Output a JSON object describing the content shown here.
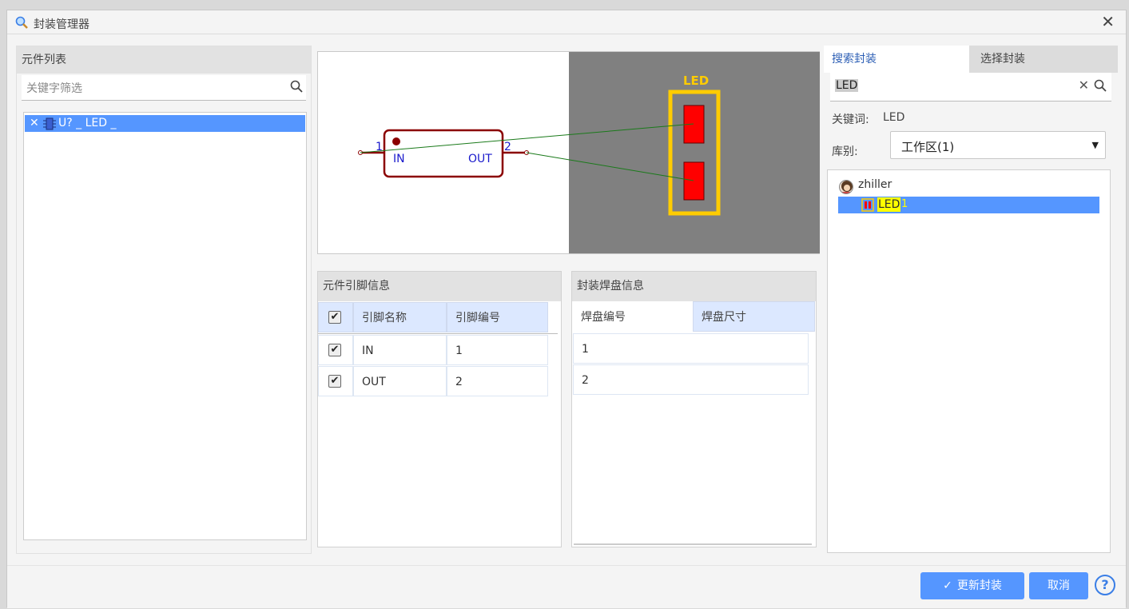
{
  "window": {
    "title": "封装管理器",
    "close_label": "✕"
  },
  "left_panel": {
    "header": "元件列表",
    "filter_placeholder": "关键字筛选",
    "items": [
      {
        "remove": "✕",
        "label": "U? _ LED _"
      }
    ]
  },
  "preview": {
    "symbol": {
      "pin1_number": "1",
      "pin1_name": "IN",
      "pin2_number": "2",
      "pin2_name": "OUT"
    },
    "footprint": {
      "silk_label": "LED"
    }
  },
  "pin_table": {
    "header": "元件引脚信息",
    "columns": [
      "引脚名称",
      "引脚编号"
    ],
    "rows": [
      {
        "checked": true,
        "name": "IN",
        "number": "1"
      },
      {
        "checked": true,
        "name": "OUT",
        "number": "2"
      }
    ]
  },
  "pad_table": {
    "header": "封装焊盘信息",
    "columns": [
      "焊盘编号",
      "焊盘尺寸"
    ],
    "rows": [
      {
        "number": "1"
      },
      {
        "number": "2"
      }
    ]
  },
  "right_panel": {
    "tabs": [
      {
        "label": "搜索封装",
        "active": true
      },
      {
        "label": "选择封装",
        "active": false
      }
    ],
    "search_value": "LED",
    "keyword_label": "关键词:",
    "keyword_value": "LED",
    "library_label": "库别:",
    "library_value": "工作区(1)",
    "tree": {
      "user": "zhiller",
      "footprint_name": "LED",
      "footprint_suffix": "1"
    }
  },
  "footer": {
    "update_label": "更新封装",
    "cancel_label": "取消",
    "help_label": "?"
  },
  "colors": {
    "accent": "#5596ff",
    "symbol": "#8b0000",
    "pad": "#ff0000",
    "silk": "#ffcc00",
    "pcb_bg": "#808080"
  }
}
